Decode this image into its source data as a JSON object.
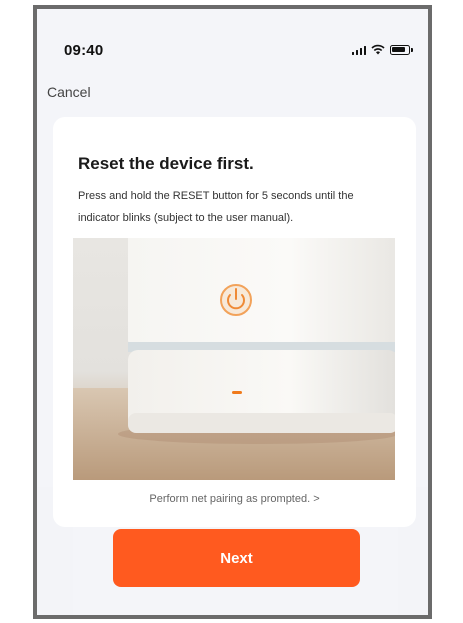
{
  "status_bar": {
    "time": "09:40",
    "icons": [
      "signal-icon",
      "wifi-icon",
      "battery-icon"
    ]
  },
  "nav": {
    "cancel_label": "Cancel"
  },
  "card": {
    "title": "Reset the device first.",
    "description": "Press and hold the RESET button for 5 seconds until the indicator blinks (subject to the user manual).",
    "image_icon": "power-icon",
    "pairing_link": "Perform net pairing as prompted. >"
  },
  "actions": {
    "next_label": "Next"
  },
  "colors": {
    "accent": "#ff5a1f",
    "indicator": "#f07a1a",
    "background": "#f4f5f9"
  }
}
